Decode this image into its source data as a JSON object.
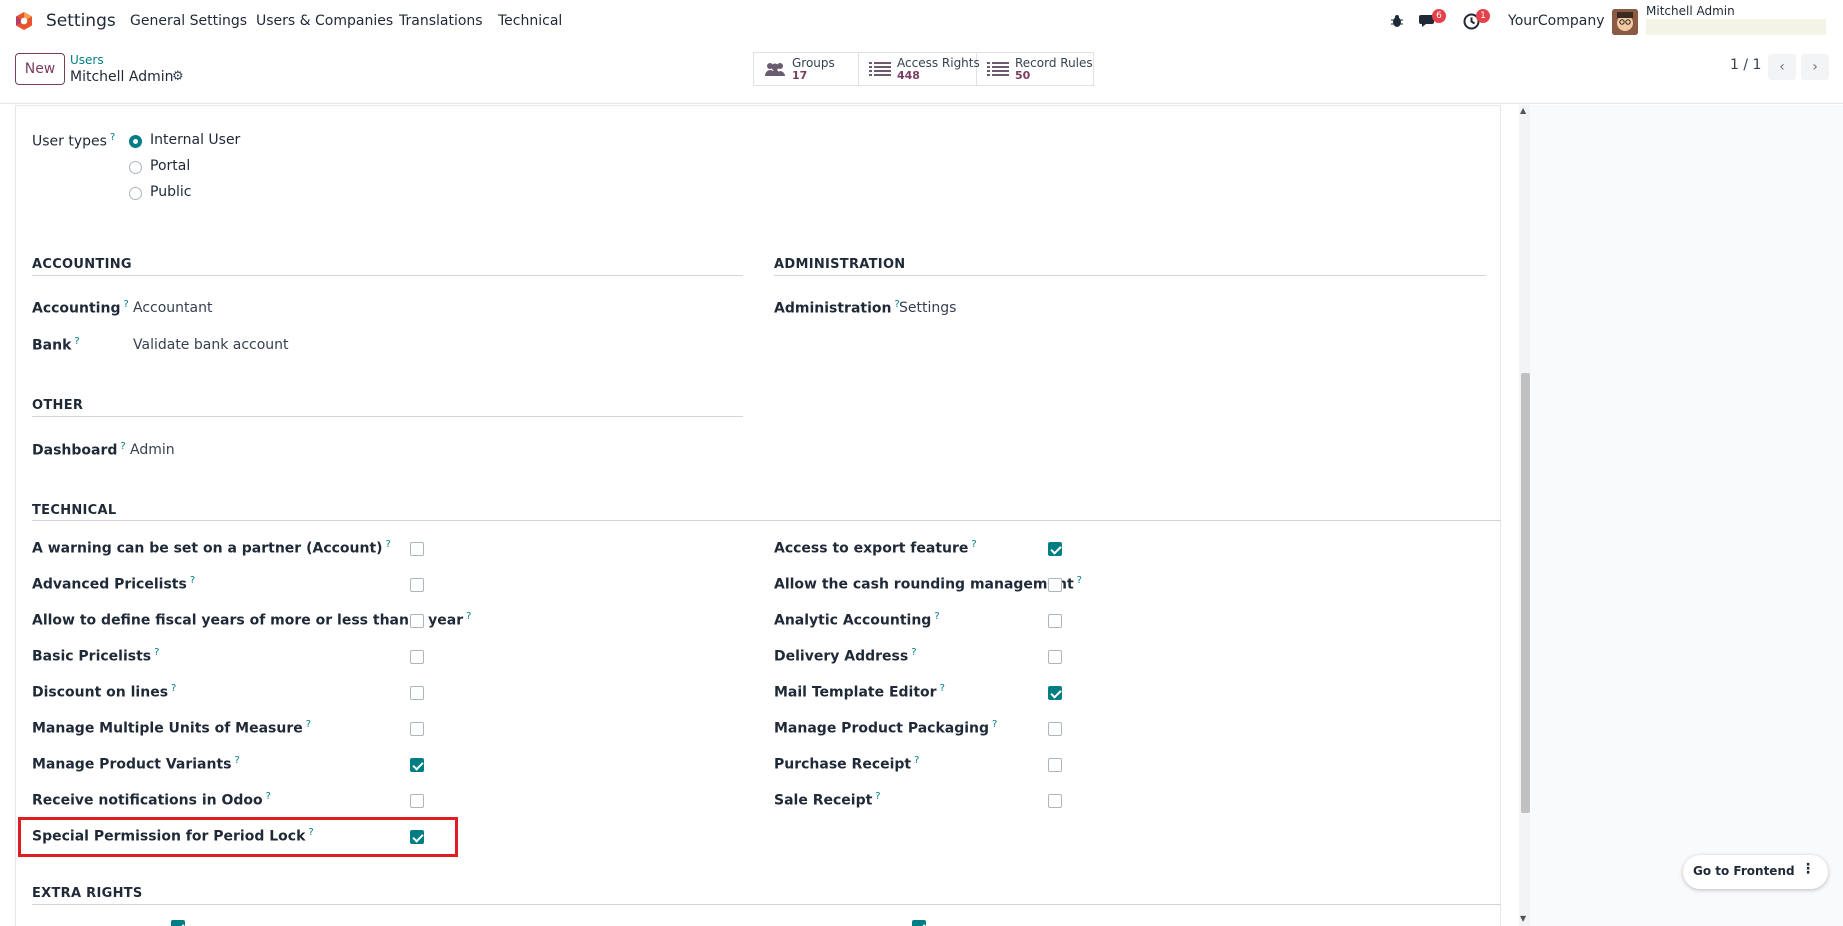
{
  "app": {
    "title": "Settings"
  },
  "nav": {
    "items": [
      "General Settings",
      "Users & Companies",
      "Translations",
      "Technical"
    ]
  },
  "systray": {
    "messages_badge": "6",
    "activity_badge": "1",
    "company": "YourCompany",
    "user_name": "Mitchell Admin"
  },
  "control": {
    "new_label": "New",
    "breadcrumb": "Users",
    "record_name": "Mitchell Admin",
    "pager": "1 / 1"
  },
  "smart_buttons": [
    {
      "label": "Groups",
      "value": "17"
    },
    {
      "label": "Access Rights",
      "value": "448"
    },
    {
      "label": "Record Rules",
      "value": "50"
    }
  ],
  "user_types": {
    "label": "User types",
    "options": [
      {
        "label": "Internal User",
        "selected": true
      },
      {
        "label": "Portal",
        "selected": false
      },
      {
        "label": "Public",
        "selected": false
      }
    ]
  },
  "accounting_section": {
    "title": "ACCOUNTING",
    "fields": [
      {
        "label": "Accounting",
        "value": "Accountant"
      },
      {
        "label": "Bank",
        "value": "Validate bank account"
      }
    ]
  },
  "administration_section": {
    "title": "ADMINISTRATION",
    "fields": [
      {
        "label": "Administration",
        "value": "Settings"
      }
    ]
  },
  "other_section": {
    "title": "OTHER",
    "fields": [
      {
        "label": "Dashboard",
        "value": "Admin"
      }
    ]
  },
  "technical_section": {
    "title": "TECHNICAL",
    "left": [
      {
        "label": "A warning can be set on a partner (Account)",
        "checked": false
      },
      {
        "label": "Advanced Pricelists",
        "checked": false
      },
      {
        "label": "Allow to define fiscal years of more or less than a year",
        "checked": false
      },
      {
        "label": "Basic Pricelists",
        "checked": false
      },
      {
        "label": "Discount on lines",
        "checked": false
      },
      {
        "label": "Manage Multiple Units of Measure",
        "checked": false
      },
      {
        "label": "Manage Product Variants",
        "checked": true
      },
      {
        "label": "Receive notifications in Odoo",
        "checked": false
      },
      {
        "label": "Special Permission for Period Lock",
        "checked": true
      }
    ],
    "right": [
      {
        "label": "Access to export feature",
        "checked": true
      },
      {
        "label": "Allow the cash rounding management",
        "checked": false
      },
      {
        "label": "Analytic Accounting",
        "checked": false
      },
      {
        "label": "Delivery Address",
        "checked": false
      },
      {
        "label": "Mail Template Editor",
        "checked": true
      },
      {
        "label": "Manage Product Packaging",
        "checked": false
      },
      {
        "label": "Purchase Receipt",
        "checked": false
      },
      {
        "label": "Sale Receipt",
        "checked": false
      }
    ]
  },
  "extra_rights_section": {
    "title": "EXTRA RIGHTS"
  },
  "help_mark": "?",
  "frontend_button": {
    "label": "Go to Frontend",
    "menu": "⋮"
  }
}
